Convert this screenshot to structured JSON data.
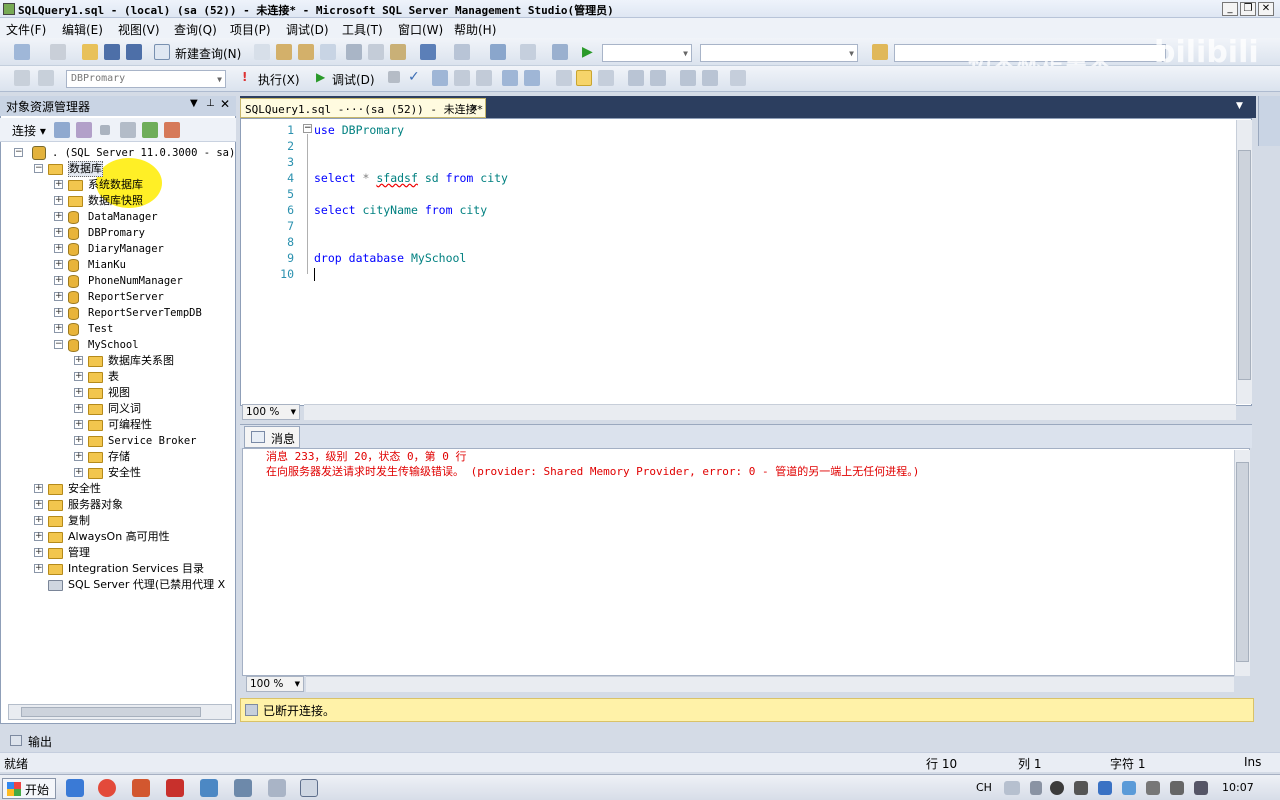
{
  "window": {
    "title": "SQLQuery1.sql - (local) (sa (52)) - 未连接* - Microsoft SQL Server Management Studio(管理员)",
    "controls": [
      "_",
      "❐",
      "✕"
    ]
  },
  "menu": [
    "文件(F)",
    "编辑(E)",
    "视图(V)",
    "查询(Q)",
    "项目(P)",
    "调试(D)",
    "工具(T)",
    "窗口(W)",
    "帮助(H)"
  ],
  "toolbar1": {
    "new_query": "新建查询(N)"
  },
  "toolbar2": {
    "database_combo": "DBPromary",
    "execute": "执行(X)",
    "debug": "调试(D)"
  },
  "watermark": "初来就是重来",
  "object_explorer": {
    "title": "对象资源管理器",
    "connect": "连接",
    "server": ". (SQL Server 11.0.3000 - sa)",
    "nodes": [
      {
        "label": "数据库",
        "expander": "−"
      },
      {
        "label": "系统数据库",
        "expander": "+"
      },
      {
        "label": "数据库快照",
        "expander": "+"
      },
      {
        "label": "DataManager",
        "expander": "+"
      },
      {
        "label": "DBPromary",
        "expander": "+"
      },
      {
        "label": "DiaryManager",
        "expander": "+"
      },
      {
        "label": "MianKu",
        "expander": "+"
      },
      {
        "label": "PhoneNumManager",
        "expander": "+"
      },
      {
        "label": "ReportServer",
        "expander": "+"
      },
      {
        "label": "ReportServerTempDB",
        "expander": "+"
      },
      {
        "label": "Test",
        "expander": "+"
      },
      {
        "label": "MySchool",
        "expander": "−"
      },
      {
        "label": "数据库关系图",
        "expander": "+"
      },
      {
        "label": "表",
        "expander": "+"
      },
      {
        "label": "视图",
        "expander": "+"
      },
      {
        "label": "同义词",
        "expander": "+"
      },
      {
        "label": "可编程性",
        "expander": "+"
      },
      {
        "label": "Service Broker",
        "expander": "+"
      },
      {
        "label": "存储",
        "expander": "+"
      },
      {
        "label": "安全性",
        "expander": "+"
      },
      {
        "label": "安全性",
        "expander": "+"
      },
      {
        "label": "服务器对象",
        "expander": "+"
      },
      {
        "label": "复制",
        "expander": "+"
      },
      {
        "label": "AlwaysOn 高可用性",
        "expander": "+"
      },
      {
        "label": "管理",
        "expander": "+"
      },
      {
        "label": "Integration Services 目录",
        "expander": "+"
      },
      {
        "label": "SQL Server 代理(已禁用代理 X",
        "expander": ""
      }
    ]
  },
  "editor": {
    "tab_label": "SQLQuery1.sql -···(sa (52)) - 未连接*",
    "line_numbers": [
      "1",
      "2",
      "3",
      "4",
      "5",
      "6",
      "7",
      "8",
      "9",
      "10"
    ],
    "zoom": "100 %"
  },
  "messages": {
    "tab_label": "消息",
    "line1": "消息 233，级别 20，状态 0，第 0 行",
    "line2": "在向服务器发送请求时发生传输级错误。 (provider: Shared Memory Provider, error: 0 - 管道的另一端上无任何进程。)",
    "zoom": "100 %"
  },
  "connection_status": "已断开连接。",
  "output_tab": "输出",
  "statusbar": {
    "ready": "就绪",
    "row": "行 10",
    "col": "列 1",
    "char": "字符 1",
    "mode": "Ins"
  },
  "taskbar": {
    "start": "开始",
    "lang": "CH",
    "time": "10:07"
  }
}
